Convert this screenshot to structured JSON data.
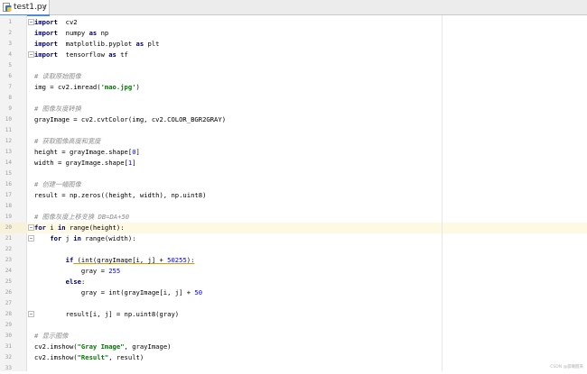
{
  "tab": {
    "filename": "test1.py",
    "close": "×"
  },
  "lines": [
    {
      "n": "1",
      "parts": [
        [
          "k",
          "import"
        ],
        [
          "",
          "  cv2"
        ]
      ]
    },
    {
      "n": "2",
      "parts": [
        [
          "k",
          "import"
        ],
        [
          "",
          "  numpy "
        ],
        [
          "k",
          "as"
        ],
        [
          "",
          " np"
        ]
      ]
    },
    {
      "n": "3",
      "parts": [
        [
          "k",
          "import"
        ],
        [
          "",
          "  matplotlib.pyplot "
        ],
        [
          "k",
          "as"
        ],
        [
          "",
          " plt"
        ]
      ]
    },
    {
      "n": "4",
      "parts": [
        [
          "k",
          "import"
        ],
        [
          "",
          "  tensorflow "
        ],
        [
          "k",
          "as"
        ],
        [
          "",
          " tf"
        ]
      ]
    },
    {
      "n": "5",
      "parts": []
    },
    {
      "n": "6",
      "parts": [
        [
          "c",
          "# 读取原始图像"
        ]
      ]
    },
    {
      "n": "7",
      "parts": [
        [
          "",
          "img = cv2.imread("
        ],
        [
          "s",
          "'mao.jpg'"
        ],
        [
          "",
          ")"
        ]
      ]
    },
    {
      "n": "8",
      "parts": []
    },
    {
      "n": "9",
      "parts": [
        [
          "c",
          "# 图像灰度转换"
        ]
      ]
    },
    {
      "n": "10",
      "parts": [
        [
          "",
          "grayImage = cv2.cvtColor(img, cv2.COLOR_BGR2GRAY)"
        ]
      ]
    },
    {
      "n": "11",
      "parts": []
    },
    {
      "n": "12",
      "parts": [
        [
          "c",
          "# 获取图像高度和宽度"
        ]
      ]
    },
    {
      "n": "13",
      "parts": [
        [
          "",
          "height = grayImage.shape["
        ],
        [
          "n",
          "0"
        ],
        [
          "",
          "]"
        ]
      ]
    },
    {
      "n": "14",
      "parts": [
        [
          "",
          "width = grayImage.shape["
        ],
        [
          "n",
          "1"
        ],
        [
          "",
          "]"
        ]
      ]
    },
    {
      "n": "15",
      "parts": []
    },
    {
      "n": "16",
      "parts": [
        [
          "c",
          "# 创建一幅图像"
        ]
      ]
    },
    {
      "n": "17",
      "parts": [
        [
          "",
          "result = np.zeros((height, width), np.uint8)"
        ]
      ]
    },
    {
      "n": "18",
      "parts": []
    },
    {
      "n": "19",
      "parts": [
        [
          "c",
          "# 图像灰度上移变换 DB=DA+50"
        ]
      ]
    },
    {
      "n": "20",
      "parts": [
        [
          "k",
          "for"
        ],
        [
          "",
          " i "
        ],
        [
          "k",
          "in"
        ],
        [
          "",
          " range(height):"
        ]
      ]
    },
    {
      "n": "21",
      "parts": [
        [
          "",
          "    "
        ],
        [
          "k",
          "for"
        ],
        [
          "",
          " j "
        ],
        [
          "k",
          "in"
        ],
        [
          "",
          " range(width):"
        ]
      ]
    },
    {
      "n": "22",
      "parts": []
    },
    {
      "n": "23",
      "parts": [
        [
          "",
          "        "
        ],
        [
          "k",
          "if"
        ],
        [
          "",
          " (int(grayImage[i, j] + "
        ],
        [
          "n",
          "50"
        ],
        [
          ") > "
        ],
        [
          "n",
          "255"
        ],
        [
          "",
          "):"
        ]
      ]
    },
    {
      "n": "24",
      "parts": [
        [
          "",
          "            gray = "
        ],
        [
          "n",
          "255"
        ]
      ]
    },
    {
      "n": "25",
      "parts": [
        [
          "",
          "        "
        ],
        [
          "k",
          "else"
        ],
        [
          "",
          ":"
        ]
      ]
    },
    {
      "n": "26",
      "parts": [
        [
          "",
          "            gray = int(grayImage[i, j] + "
        ],
        [
          "n",
          "50"
        ],
        [
          ")"
        ]
      ]
    },
    {
      "n": "27",
      "parts": []
    },
    {
      "n": "28",
      "parts": [
        [
          "",
          "        result[i, j] = np.uint8(gray)"
        ]
      ]
    },
    {
      "n": "29",
      "parts": []
    },
    {
      "n": "30",
      "parts": [
        [
          "c",
          "# 显示图像"
        ]
      ]
    },
    {
      "n": "31",
      "parts": [
        [
          "",
          "cv2.imshow("
        ],
        [
          "s",
          "\"Gray Image\""
        ],
        [
          "",
          ", grayImage)"
        ]
      ]
    },
    {
      "n": "32",
      "parts": [
        [
          "",
          "cv2.imshow("
        ],
        [
          "s",
          "\"Result\""
        ],
        [
          "",
          ", result)"
        ]
      ]
    },
    {
      "n": "33",
      "parts": []
    }
  ],
  "watermark": "CSDN @晨曦醒来",
  "colors": {
    "keyword": "#000080",
    "comment": "#8c8c8c",
    "string": "#007a00",
    "number": "#0000ff",
    "tab_accent": "#4a8ad8",
    "current_line": "#fdf9e3"
  }
}
